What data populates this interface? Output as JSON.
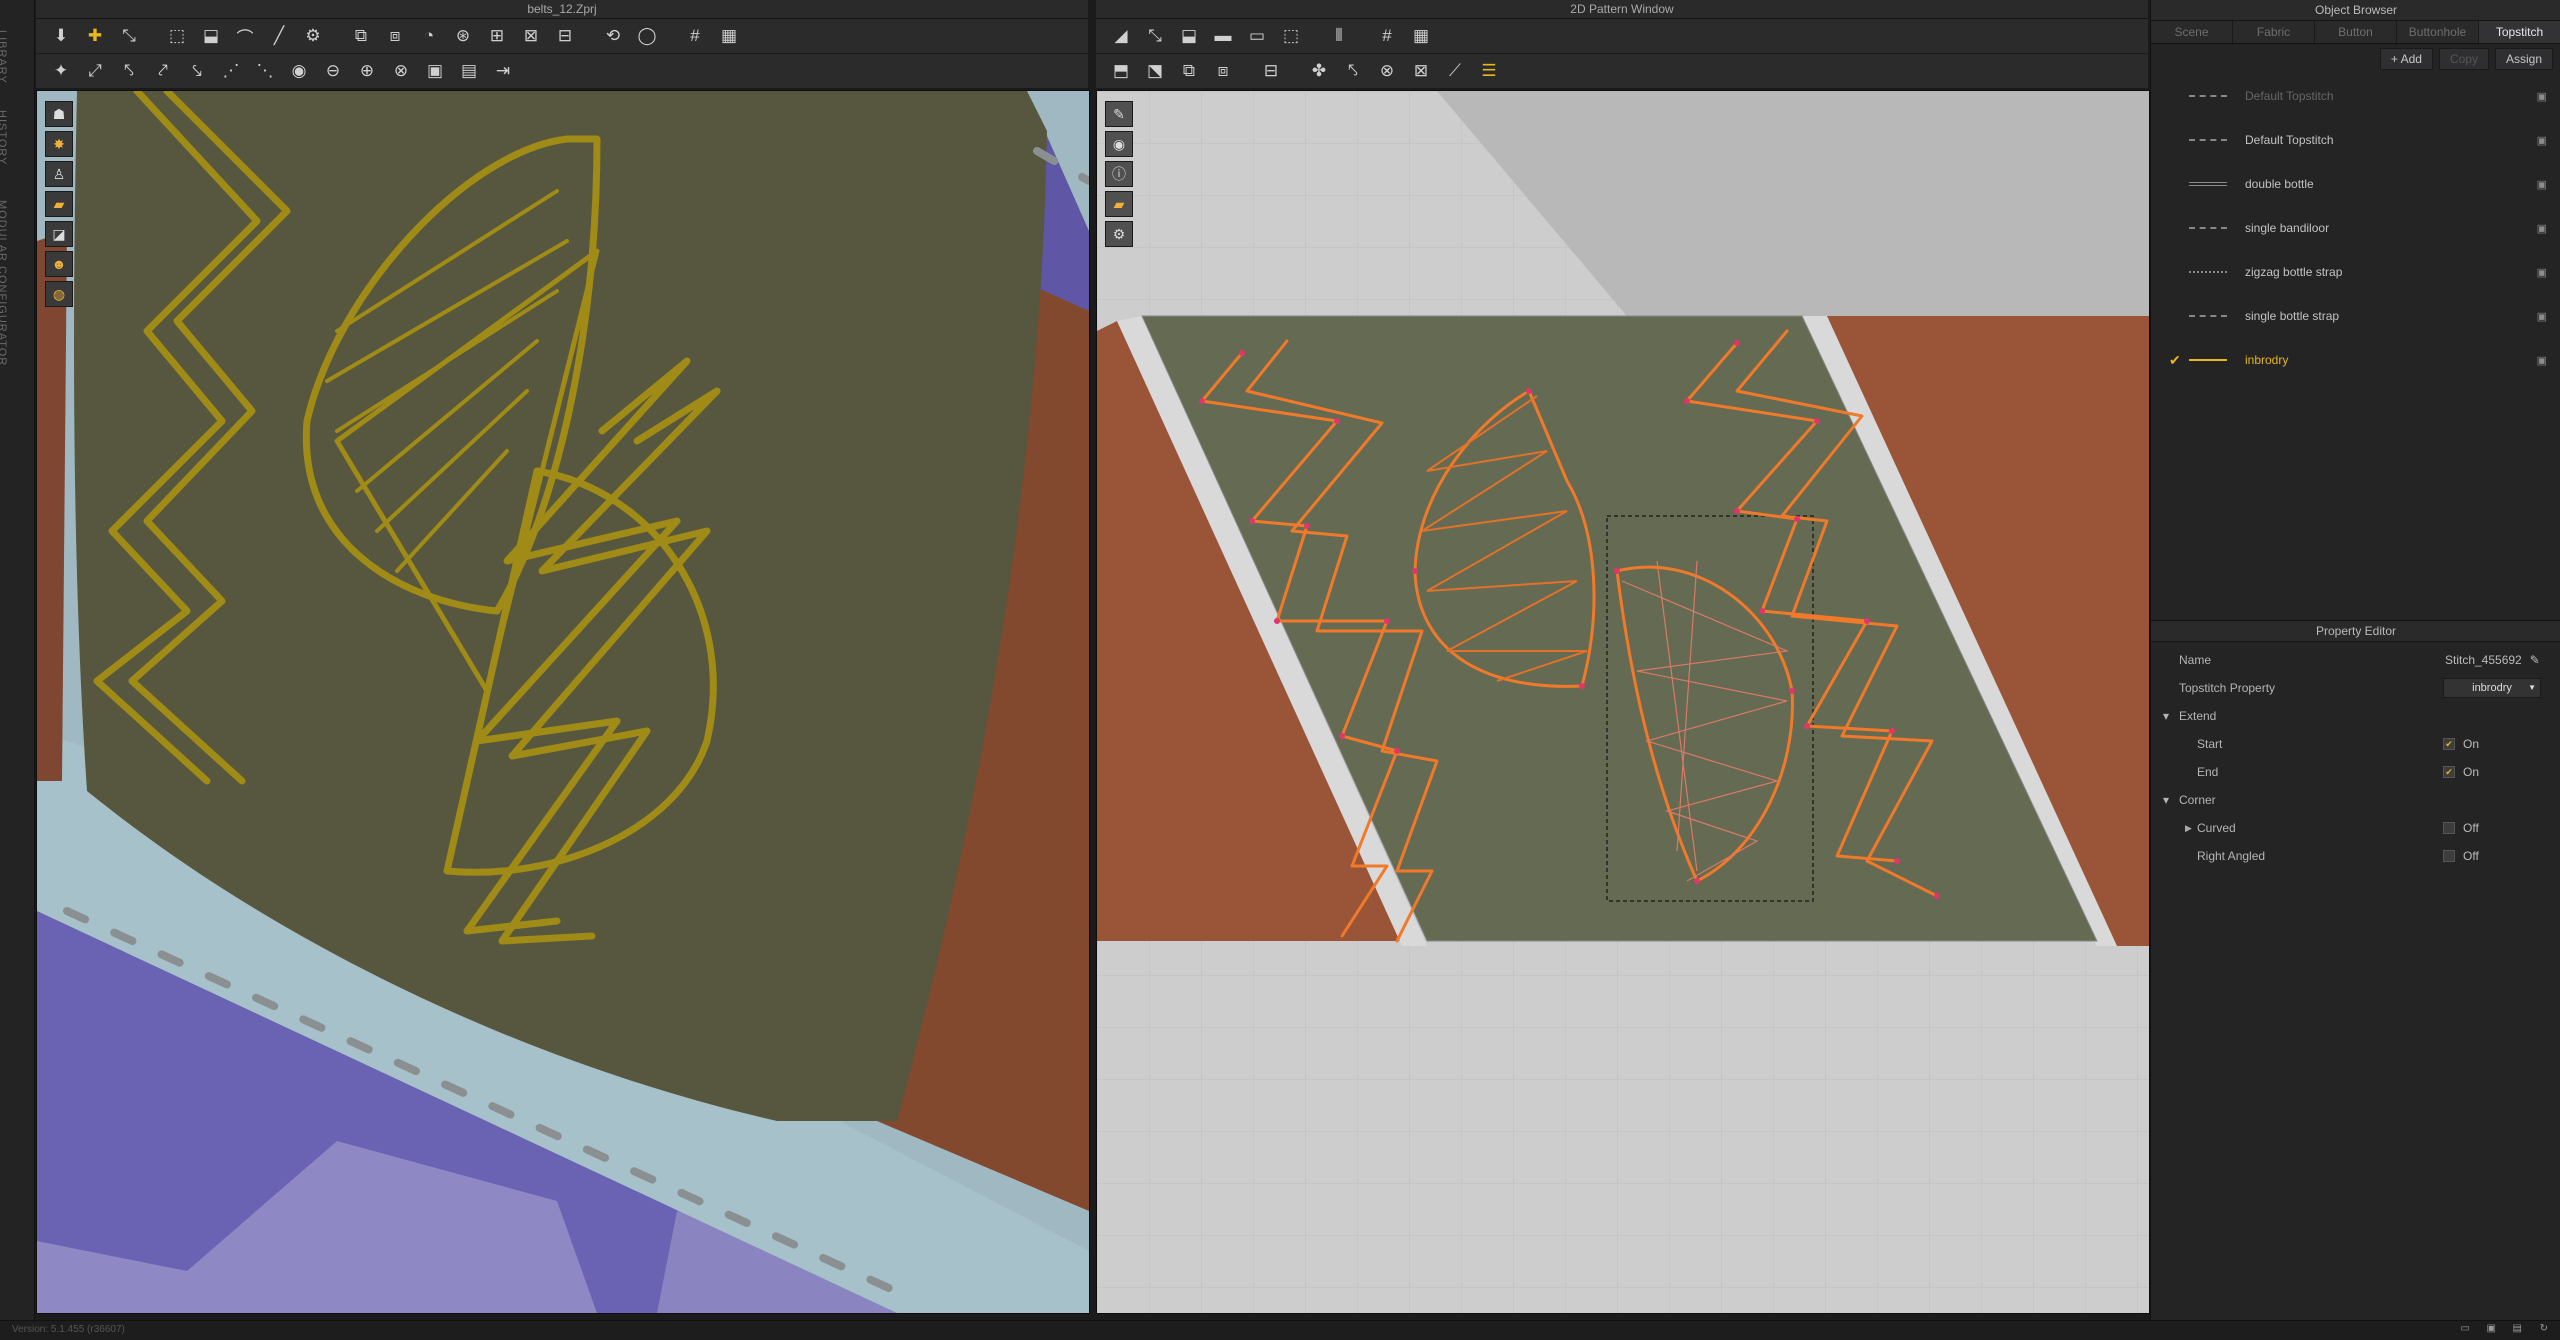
{
  "left_strip": {
    "tabs": [
      "LIBRARY",
      "HISTORY",
      "MODULAR CONFIGURATOR"
    ]
  },
  "window3d": {
    "title": "belts_12.Zprj"
  },
  "window2d": {
    "title": "2D Pattern Window"
  },
  "object_browser": {
    "title": "Object Browser",
    "tabs": [
      "Scene",
      "Fabric",
      "Button",
      "Buttonhole",
      "Topstitch"
    ],
    "active_tab": "Topstitch",
    "actions": {
      "add": "+ Add",
      "copy": "Copy",
      "assign": "Assign"
    },
    "items": [
      {
        "label": "Default Topstitch",
        "state": "dim"
      },
      {
        "label": "Default Topstitch",
        "state": "normal"
      },
      {
        "label": "double bottle",
        "state": "normal"
      },
      {
        "label": "single bandiloor",
        "state": "normal"
      },
      {
        "label": "zigzag bottle strap",
        "state": "normal"
      },
      {
        "label": "single bottle strap",
        "state": "normal"
      },
      {
        "label": "inbrodry",
        "state": "selected"
      }
    ]
  },
  "property_editor": {
    "title": "Property Editor",
    "name_label": "Name",
    "name_value": "Stitch_455692",
    "topstitch_label": "Topstitch Property",
    "topstitch_value": "inbrodry",
    "extend_label": "Extend",
    "start_label": "Start",
    "start_value": "On",
    "end_label": "End",
    "end_value": "On",
    "corner_label": "Corner",
    "curved_label": "Curved",
    "curved_value": "Off",
    "right_angled_label": "Right Angled",
    "right_angled_value": "Off"
  },
  "status": {
    "version": "Version: 5.1.455 (r36607)"
  },
  "colors": {
    "accent": "#e6b81e",
    "stitch2d": "#f07a2a",
    "fabric": "#656a52",
    "brown": "#9a5538"
  }
}
